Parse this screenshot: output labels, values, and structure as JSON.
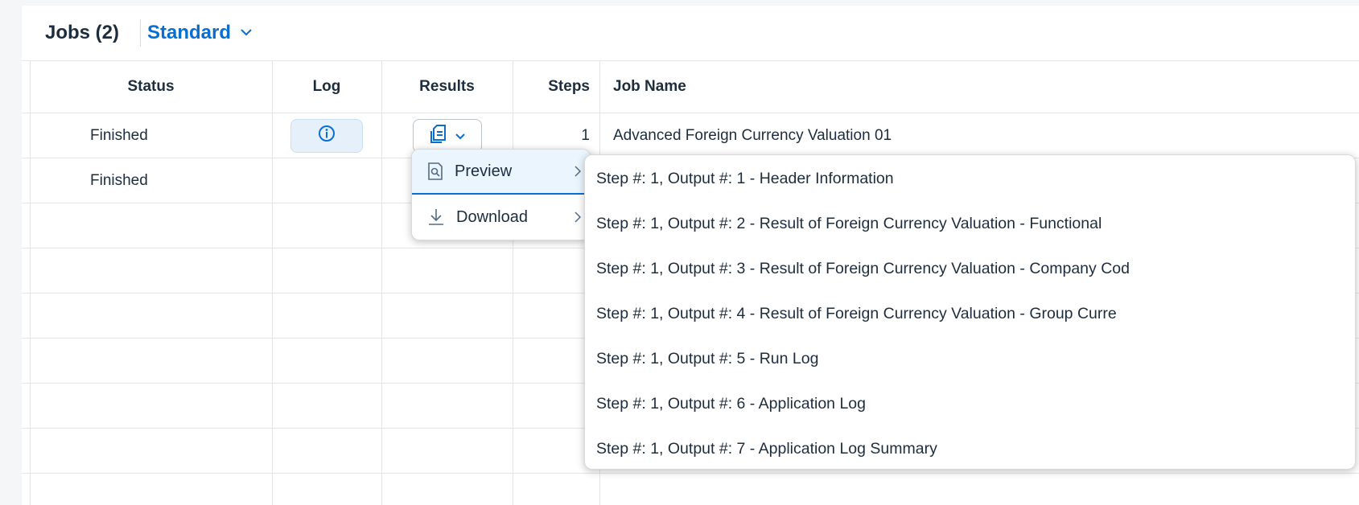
{
  "toolbar": {
    "title": "Jobs (2)",
    "variant": "Standard"
  },
  "columns": {
    "status": "Status",
    "log": "Log",
    "results": "Results",
    "steps": "Steps",
    "job_name": "Job Name"
  },
  "rows": [
    {
      "status": "Finished",
      "steps": "1",
      "job_name": "Advanced Foreign Currency Valuation 01"
    },
    {
      "status": "Finished",
      "steps": "",
      "job_name": ""
    }
  ],
  "results_menu": {
    "items": [
      {
        "label": "Preview",
        "icon": "preview-icon"
      },
      {
        "label": "Download",
        "icon": "download-icon"
      }
    ]
  },
  "preview_submenu": {
    "items": [
      "Step #: 1, Output #: 1 - Header Information",
      "Step #: 1, Output #: 2 - Result of Foreign Currency Valuation - Functional",
      "Step #: 1, Output #: 3 - Result of Foreign Currency Valuation - Company Cod",
      "Step #: 1, Output #: 4 - Result of Foreign Currency Valuation - Group Curre",
      "Step #: 1, Output #: 5 - Run Log",
      "Step #: 1, Output #: 6 - Application Log",
      "Step #: 1, Output #: 7 - Application Log Summary"
    ]
  },
  "colors": {
    "accent": "#0a6ed1",
    "text": "#1d2d3e",
    "border": "#e5e5e5"
  }
}
